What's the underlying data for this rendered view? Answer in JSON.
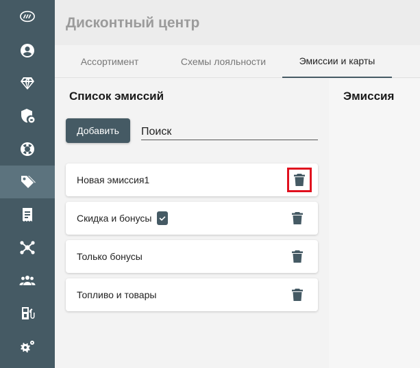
{
  "app": {
    "title": "Дисконтный центр"
  },
  "sidebar": {
    "items": [
      {
        "icon": "logo-icon"
      },
      {
        "icon": "account-icon"
      },
      {
        "icon": "diamond-icon"
      },
      {
        "icon": "shield-icon"
      },
      {
        "icon": "lifebuoy-icon"
      },
      {
        "icon": "tag-icon"
      },
      {
        "icon": "receipt-icon"
      },
      {
        "icon": "hub-icon"
      },
      {
        "icon": "people-icon"
      },
      {
        "icon": "fuel-icon"
      },
      {
        "icon": "gears-icon"
      }
    ],
    "active_index": 5
  },
  "tabs": [
    {
      "label": "Ассортимент"
    },
    {
      "label": "Схемы лояльности"
    },
    {
      "label": "Эмиссии и карты"
    }
  ],
  "active_tab": 2,
  "list": {
    "title": "Список эмиссий",
    "add_label": "Добавить",
    "search_placeholder": "Поиск",
    "items": [
      {
        "label": "Новая эмиссия1",
        "badge": false
      },
      {
        "label": "Скидка и бонусы",
        "badge": true
      },
      {
        "label": "Только бонусы",
        "badge": false
      },
      {
        "label": "Топливо и товары",
        "badge": false
      }
    ]
  },
  "detail": {
    "title": "Эмиссия"
  },
  "colors": {
    "rail": "#455a64",
    "highlight": "#e0101e"
  }
}
